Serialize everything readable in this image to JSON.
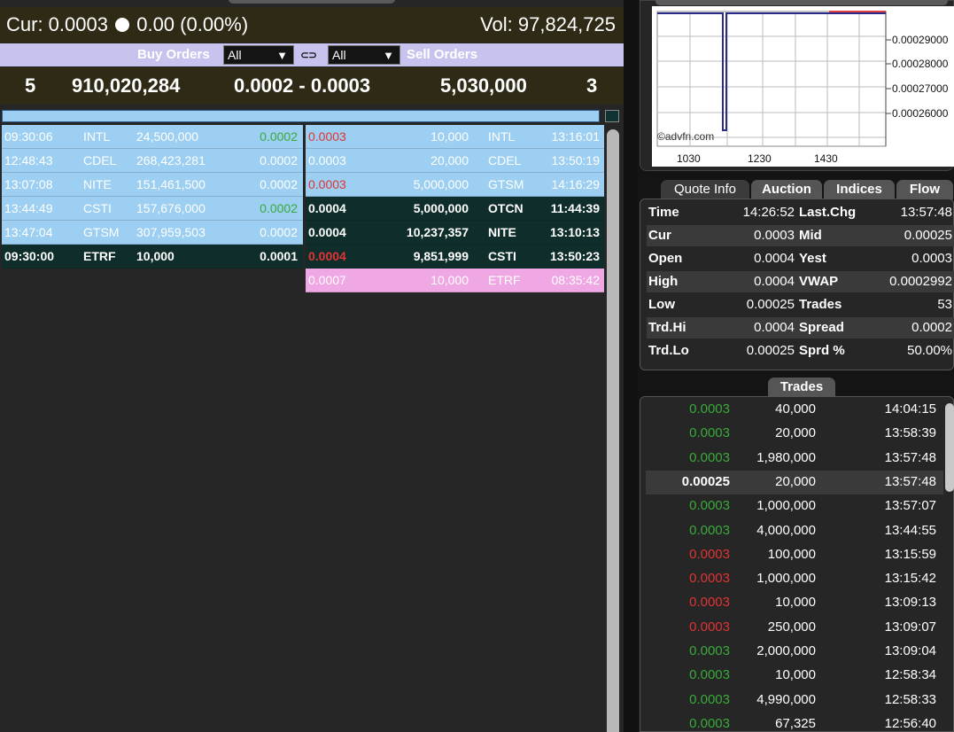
{
  "header": {
    "cur_label": "Cur: 0.0003",
    "change_text": "0.00 (0.00%)",
    "volume_text": "Vol: 97,824,725"
  },
  "filter": {
    "buy_label": "Buy Orders",
    "buy_filter": "All",
    "sell_filter": "All",
    "sell_label": "Sell Orders",
    "dropdown_arrow": "▼",
    "link_glyph": "⊂⊃"
  },
  "summary": {
    "buy_count": "5",
    "buy_volume": "910,020,284",
    "spread": "0.0002 - 0.0003",
    "sell_volume": "5,030,000",
    "sell_count": "3"
  },
  "buy_orders": [
    {
      "time": "09:30:06",
      "mm": "INTL",
      "size": "24,500,000",
      "price": "0.0002",
      "style": "blue",
      "price_color": "green"
    },
    {
      "time": "12:48:43",
      "mm": "CDEL",
      "size": "268,423,281",
      "price": "0.0002",
      "style": "blue",
      "price_color": "white"
    },
    {
      "time": "13:07:08",
      "mm": "NITE",
      "size": "151,461,500",
      "price": "0.0002",
      "style": "blue",
      "price_color": "white"
    },
    {
      "time": "13:44:49",
      "mm": "CSTI",
      "size": "157,676,000",
      "price": "0.0002",
      "style": "blue",
      "price_color": "green"
    },
    {
      "time": "13:47:04",
      "mm": "GTSM",
      "size": "307,959,503",
      "price": "0.0002",
      "style": "blue",
      "price_color": "white"
    },
    {
      "time": "09:30:00",
      "mm": "ETRF",
      "size": "10,000",
      "price": "0.0001",
      "style": "dark",
      "price_color": "white"
    }
  ],
  "sell_orders": [
    {
      "price": "0.0003",
      "size": "10,000",
      "mm": "INTL",
      "time": "13:16:01",
      "style": "blue",
      "price_color": "red"
    },
    {
      "price": "0.0003",
      "size": "20,000",
      "mm": "CDEL",
      "time": "13:50:19",
      "style": "blue",
      "price_color": "white"
    },
    {
      "price": "0.0003",
      "size": "5,000,000",
      "mm": "GTSM",
      "time": "14:16:29",
      "style": "blue",
      "price_color": "red"
    },
    {
      "price": "0.0004",
      "size": "5,000,000",
      "mm": "OTCN",
      "time": "11:44:39",
      "style": "dark",
      "price_color": "white"
    },
    {
      "price": "0.0004",
      "size": "10,237,357",
      "mm": "NITE",
      "time": "13:10:13",
      "style": "dark",
      "price_color": "white"
    },
    {
      "price": "0.0004",
      "size": "9,851,999",
      "mm": "CSTI",
      "time": "13:50:23",
      "style": "dark",
      "price_color": "red"
    },
    {
      "price": "0.0007",
      "size": "10,000",
      "mm": "ETRF",
      "time": "08:35:42",
      "style": "pink",
      "price_color": "white"
    }
  ],
  "chart": {
    "watermark": "©advfn.com",
    "x_ticks": [
      "1030",
      "1230",
      "1430"
    ],
    "y_ticks": [
      "0.00029000",
      "0.00028000",
      "0.00027000",
      "0.00026000"
    ]
  },
  "tabs": [
    "Quote Info",
    "Auction",
    "Indices",
    "Flow"
  ],
  "quote_info": [
    {
      "k1": "Time",
      "v1": "14:26:52",
      "k2": "Last.Chg",
      "v2": "13:57:48"
    },
    {
      "k1": "Cur",
      "v1": "0.0003",
      "k2": "Mid",
      "v2": "0.00025"
    },
    {
      "k1": "Open",
      "v1": "0.0004",
      "k2": "Yest",
      "v2": "0.0003"
    },
    {
      "k1": "High",
      "v1": "0.0004",
      "k2": "VWAP",
      "v2": "0.0002992"
    },
    {
      "k1": "Low",
      "v1": "0.00025",
      "k2": "Trades",
      "v2": "53"
    },
    {
      "k1": "Trd.Hi",
      "v1": "0.0004",
      "k2": "Spread",
      "v2": "0.0002"
    },
    {
      "k1": "Trd.Lo",
      "v1": "0.00025",
      "k2": "Sprd %",
      "v2": "50.00%"
    }
  ],
  "trades_label": "Trades",
  "trades": [
    {
      "price": "0.0003",
      "qty": "40,000",
      "time": "14:04:15",
      "color": "green"
    },
    {
      "price": "0.0003",
      "qty": "20,000",
      "time": "13:58:39",
      "color": "green"
    },
    {
      "price": "0.0003",
      "qty": "1,980,000",
      "time": "13:57:48",
      "color": "green"
    },
    {
      "price": "0.00025",
      "qty": "20,000",
      "time": "13:57:48",
      "color": "white"
    },
    {
      "price": "0.0003",
      "qty": "1,000,000",
      "time": "13:57:07",
      "color": "green"
    },
    {
      "price": "0.0003",
      "qty": "4,000,000",
      "time": "13:44:55",
      "color": "green"
    },
    {
      "price": "0.0003",
      "qty": "100,000",
      "time": "13:15:59",
      "color": "red"
    },
    {
      "price": "0.0003",
      "qty": "1,000,000",
      "time": "13:15:42",
      "color": "red"
    },
    {
      "price": "0.0003",
      "qty": "10,000",
      "time": "13:09:13",
      "color": "red"
    },
    {
      "price": "0.0003",
      "qty": "250,000",
      "time": "13:09:07",
      "color": "red"
    },
    {
      "price": "0.0003",
      "qty": "2,000,000",
      "time": "13:09:04",
      "color": "green"
    },
    {
      "price": "0.0003",
      "qty": "10,000",
      "time": "12:58:34",
      "color": "green"
    },
    {
      "price": "0.0003",
      "qty": "4,990,000",
      "time": "12:58:33",
      "color": "green"
    },
    {
      "price": "0.0003",
      "qty": "67,325",
      "time": "12:56:40",
      "color": "green"
    }
  ],
  "colors": {
    "green": "#3aaa3a",
    "red": "#e03434",
    "white": "#ffffff",
    "buy_row": "#9ccff2",
    "dark_row": "#0f2e2b",
    "pink_row": "#f0a8e4",
    "header_bg": "#2e2a15",
    "filter_bg": "#c6c4ee"
  }
}
